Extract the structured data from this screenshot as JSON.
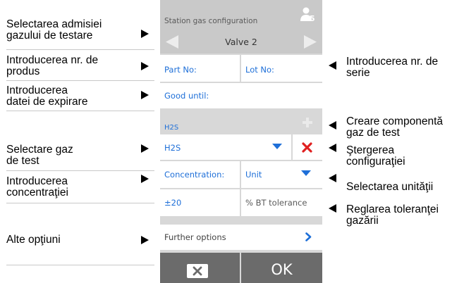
{
  "left_labels": [
    {
      "line1": "Selectarea admisiei",
      "line2": "gazului de testare"
    },
    {
      "line1": "Introducerea nr. de",
      "line2": "produs"
    },
    {
      "line1": "Introducerea",
      "line2": "datei de expirare"
    },
    {
      "line1": "Selectare gaz",
      "line2": "de test"
    },
    {
      "line1": "Introducerea",
      "line2": "concentraţiei"
    },
    {
      "line1": "Alte opţiuni",
      "line2": ""
    }
  ],
  "right_labels": [
    {
      "line1": "Introducerea nr. de",
      "line2": "serie"
    },
    {
      "line1": "Creare componentă",
      "line2": "gaz de test"
    },
    {
      "line1": "Ştergerea",
      "line2": "configuraţiei"
    },
    {
      "line1": "Selectarea unităţii",
      "line2": ""
    },
    {
      "line1": "Reglarea toleranţei",
      "line2": "gazării"
    }
  ],
  "screen": {
    "title": "Station gas configuration",
    "user_badge": "5",
    "valve_label": "Valve 2",
    "part_no_placeholder": "Part No:",
    "lot_no_placeholder": "Lot No:",
    "good_until_placeholder": "Good until:",
    "component_header": "H2S",
    "gas_selected": "H2S",
    "concentration_label": "Concentration:",
    "unit_selected": "Unit",
    "tolerance_value": "±20",
    "tolerance_label": "% BT tolerance",
    "further_options_label": "Further options",
    "ok_label": "OK"
  },
  "colors": {
    "accent": "#1e6fd8",
    "delete": "#e02020",
    "footer": "#6b6b6b"
  }
}
